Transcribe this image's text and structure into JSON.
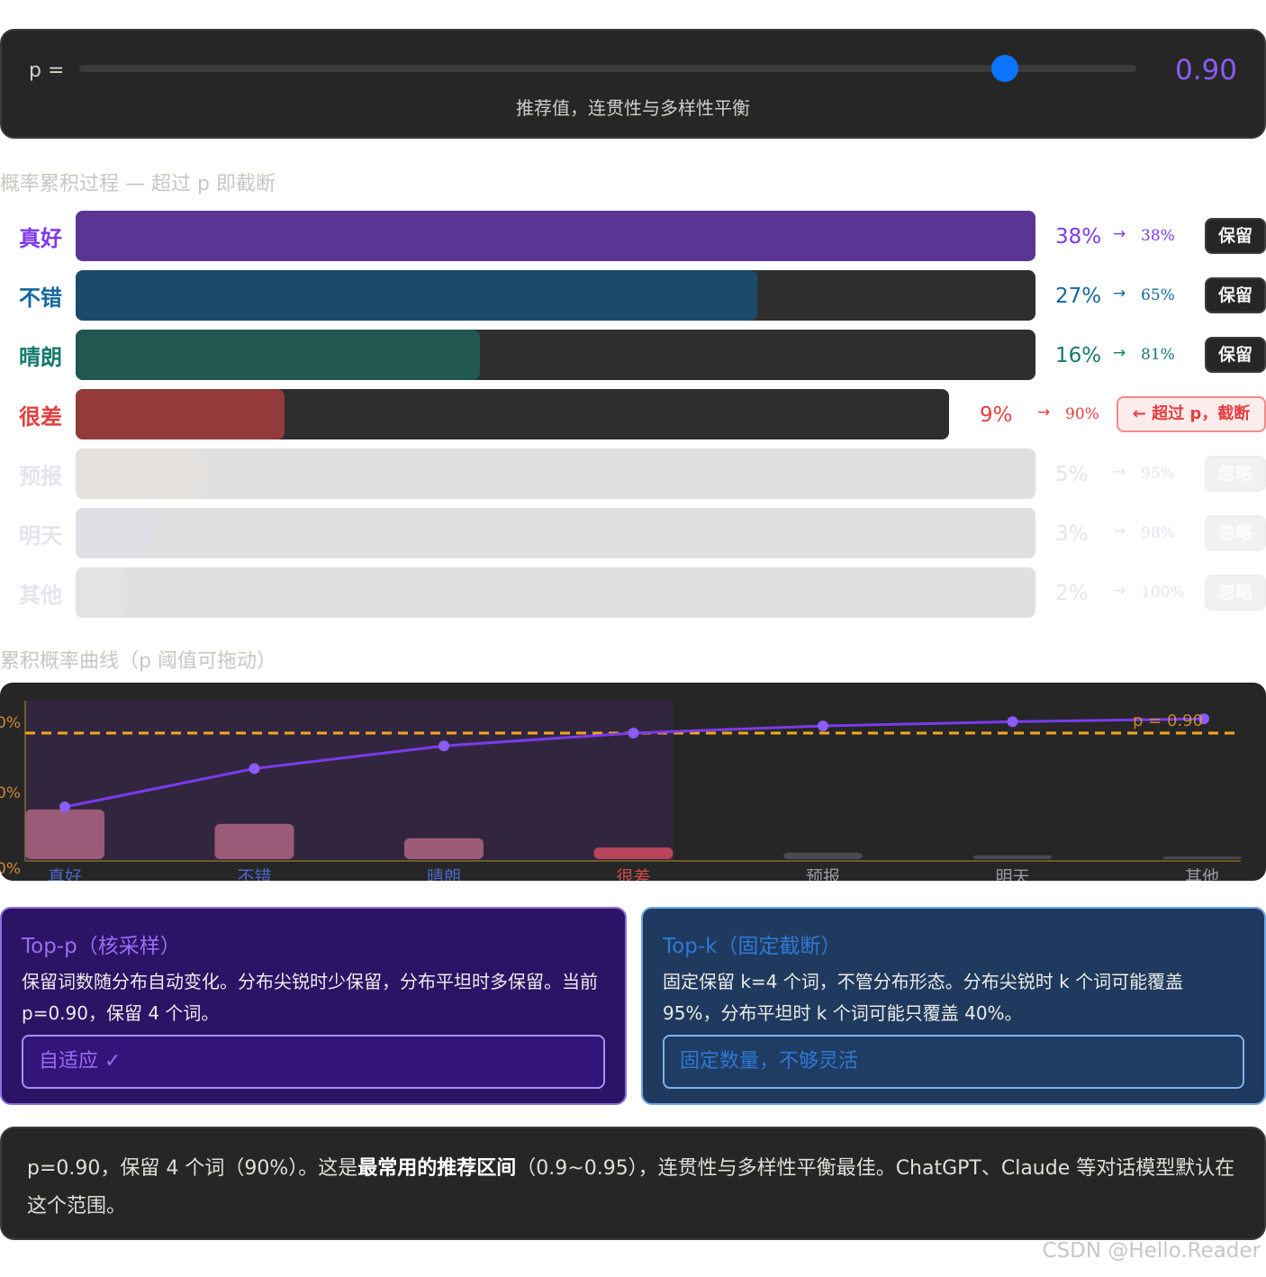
{
  "slider": {
    "label": "p =",
    "value": 0.9,
    "value_text": "0.90",
    "hint": "推荐值，连贯性与多样性平衡"
  },
  "section_accumulate_title": "概率累积过程 — 超过 p 即截断",
  "tokens": [
    {
      "word": "真好",
      "prob": 38,
      "prob_text": "38%",
      "cum_text": "38%",
      "status": "保留",
      "state": "keep",
      "color": "#7c3aed",
      "bar_color": "#5b3593"
    },
    {
      "word": "不错",
      "prob": 27,
      "prob_text": "27%",
      "cum_text": "65%",
      "status": "保留",
      "state": "keep",
      "color": "#14679c",
      "bar_color": "#1b4b6b"
    },
    {
      "word": "晴朗",
      "prob": 16,
      "prob_text": "16%",
      "cum_text": "81%",
      "status": "保留",
      "state": "keep",
      "color": "#147a6c",
      "bar_color": "#20574e"
    },
    {
      "word": "很差",
      "prob": 9,
      "prob_text": "9%",
      "cum_text": "90%",
      "status": "← 超过 p，截断",
      "state": "cut",
      "color": "#e53e3e",
      "bar_color": "#943a3a"
    },
    {
      "word": "预报",
      "prob": 5,
      "prob_text": "5%",
      "cum_text": "95%",
      "status": "忽略",
      "state": "ignore",
      "color": "#ccd0dd",
      "bar_color": "#cfc9c4"
    },
    {
      "word": "明天",
      "prob": 3,
      "prob_text": "3%",
      "cum_text": "98%",
      "status": "忽略",
      "state": "ignore",
      "color": "#ccd0dd",
      "bar_color": "#c9c6d3"
    },
    {
      "word": "其他",
      "prob": 2,
      "prob_text": "2%",
      "cum_text": "100%",
      "status": "忽略",
      "state": "ignore",
      "color": "#ccd0dd",
      "bar_color": "#cdcdcf"
    }
  ],
  "arrow": "→",
  "section_curve_title": "累积概率曲线（p 阈值可拖动）",
  "chart_data": {
    "type": "line",
    "categories": [
      "真好",
      "不错",
      "晴朗",
      "很差",
      "预报",
      "明天",
      "其他"
    ],
    "series": [
      {
        "values": [
          38,
          65,
          81,
          90,
          95,
          98,
          100
        ]
      },
      {
        "values": [
          38,
          27,
          16,
          9,
          5,
          3,
          2
        ]
      }
    ],
    "threshold": 90,
    "threshold_label": "p = 0.90",
    "y_tick_labels": [
      "0%",
      "0%",
      "0%"
    ],
    "ylim": [
      0,
      100
    ],
    "line_color": "#7c3aed",
    "threshold_color": "#f2a81d",
    "bar_color": "#9c5b78"
  },
  "card_topp": {
    "title": "Top-p（核采样）",
    "body": "保留词数随分布自动变化。分布尖锐时少保留，分布平坦时多保留。当前 p=0.90，保留 4 个词。",
    "verdict": "自适应 ✓"
  },
  "card_topk": {
    "title": "Top-k（固定截断）",
    "body": "固定保留 k=4 个词，不管分布形态。分布尖锐时 k 个词可能覆盖 95%，分布平坦时 k 个词可能只覆盖 40%。",
    "verdict": "固定数量，不够灵活"
  },
  "summary": {
    "pre": "p=0.90，保留 4 个词（90%）。这是",
    "bold": "最常用的推荐区间",
    "post": "（0.9~0.95），连贯性与多样性平衡最佳。ChatGPT、Claude 等对话模型默认在这个范围。"
  },
  "watermark": "CSDN @Hello.Reader"
}
